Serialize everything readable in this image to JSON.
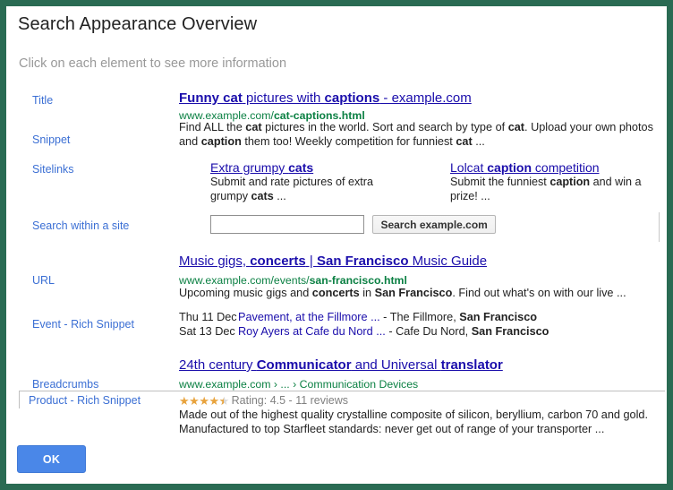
{
  "dialog": {
    "title": "Search Appearance Overview",
    "subtitle": "Click on each element to see more information",
    "ok_label": "OK",
    "border_color": "#2a6b53",
    "accent_color": "#3b6fd4"
  },
  "labels": {
    "title": "Title",
    "snippet": "Snippet",
    "sitelinks": "Sitelinks",
    "search_within_site": "Search within a site",
    "url": "URL",
    "event_rich_snippet": "Event - Rich Snippet",
    "breadcrumbs": "Breadcrumbs",
    "product_rich_snippet": "Product - Rich Snippet"
  },
  "result_1": {
    "title_parts": [
      {
        "text": "Funny cat",
        "bold": true
      },
      {
        "text": " pictures with ",
        "bold": false
      },
      {
        "text": "captions",
        "bold": true
      },
      {
        "text": " - example.com",
        "bold": false
      }
    ],
    "url_parts": [
      {
        "text": "www.example.com/",
        "bold": false
      },
      {
        "text": "cat-captions.html",
        "bold": true
      }
    ],
    "snippet_parts": [
      {
        "text": "Find ALL the ",
        "bold": false
      },
      {
        "text": "cat",
        "bold": true
      },
      {
        "text": " pictures in the world. Sort and search by type of ",
        "bold": false
      },
      {
        "text": "cat",
        "bold": true
      },
      {
        "text": ". Upload your own photos and ",
        "bold": false
      },
      {
        "text": "caption",
        "bold": true
      },
      {
        "text": " them too! Weekly competition for funniest ",
        "bold": false
      },
      {
        "text": "cat",
        "bold": true
      },
      {
        "text": " ...",
        "bold": false
      }
    ]
  },
  "sitelinks": [
    {
      "title_parts": [
        {
          "text": "Extra grumpy ",
          "bold": false
        },
        {
          "text": "cats",
          "bold": true
        }
      ],
      "desc_parts": [
        {
          "text": "Submit and rate pictures of extra grumpy ",
          "bold": false
        },
        {
          "text": "cats",
          "bold": true
        },
        {
          "text": " ...",
          "bold": false
        }
      ]
    },
    {
      "title_parts": [
        {
          "text": "Lolcat ",
          "bold": false
        },
        {
          "text": "caption",
          "bold": true
        },
        {
          "text": " competition",
          "bold": false
        }
      ],
      "desc_parts": [
        {
          "text": "Submit the funniest ",
          "bold": false
        },
        {
          "text": "caption",
          "bold": true
        },
        {
          "text": " and win a prize! ...",
          "bold": false
        }
      ]
    }
  ],
  "search_within_site": {
    "input_value": "",
    "input_placeholder": "",
    "button_label": "Search example.com"
  },
  "result_2": {
    "title_parts": [
      {
        "text": "Music gigs, ",
        "bold": false
      },
      {
        "text": "concerts",
        "bold": true
      },
      {
        "text": " | ",
        "bold": false
      },
      {
        "text": "San Francisco",
        "bold": true
      },
      {
        "text": " Music Guide",
        "bold": false
      }
    ],
    "url_parts": [
      {
        "text": "www.example.com/events/",
        "bold": false
      },
      {
        "text": "san-francisco.html",
        "bold": true
      }
    ],
    "snippet_parts": [
      {
        "text": "Upcoming music gigs and ",
        "bold": false
      },
      {
        "text": "concerts",
        "bold": true
      },
      {
        "text": " in ",
        "bold": false
      },
      {
        "text": "San Francisco",
        "bold": true
      },
      {
        "text": ". Find out what's on with our live ...",
        "bold": false
      }
    ],
    "events": [
      {
        "date": "Thu 11 Dec",
        "link": "Pavement, at the Fillmore ...",
        "venue_parts": [
          {
            "text": " - The Fillmore, ",
            "bold": false
          },
          {
            "text": "San Francisco",
            "bold": true
          }
        ]
      },
      {
        "date": "Sat 13 Dec",
        "link": "Roy Ayers at Cafe du Nord ...",
        "venue_parts": [
          {
            "text": " - Cafe Du Nord, ",
            "bold": false
          },
          {
            "text": "San Francisco",
            "bold": true
          }
        ]
      }
    ]
  },
  "result_3": {
    "title_parts": [
      {
        "text": "24th century ",
        "bold": false
      },
      {
        "text": "Communicator",
        "bold": true
      },
      {
        "text": " and Universal ",
        "bold": false
      },
      {
        "text": "translator",
        "bold": true
      }
    ],
    "breadcrumb_text": "www.example.com › ... › Communication Devices",
    "rating": {
      "stars_full": 4,
      "stars_half": 1,
      "stars_total": 5,
      "value": 4.5,
      "reviews": 11,
      "text": "Rating: 4.5 - 11 reviews",
      "star_color": "#e8a33d"
    },
    "snippet_parts": [
      {
        "text": "Made out of the highest quality crystalline composite of silicon, beryllium, carbon 70 and gold. Manufactured to top Starfleet standards: never get out of range of your transporter ...",
        "bold": false
      }
    ]
  }
}
